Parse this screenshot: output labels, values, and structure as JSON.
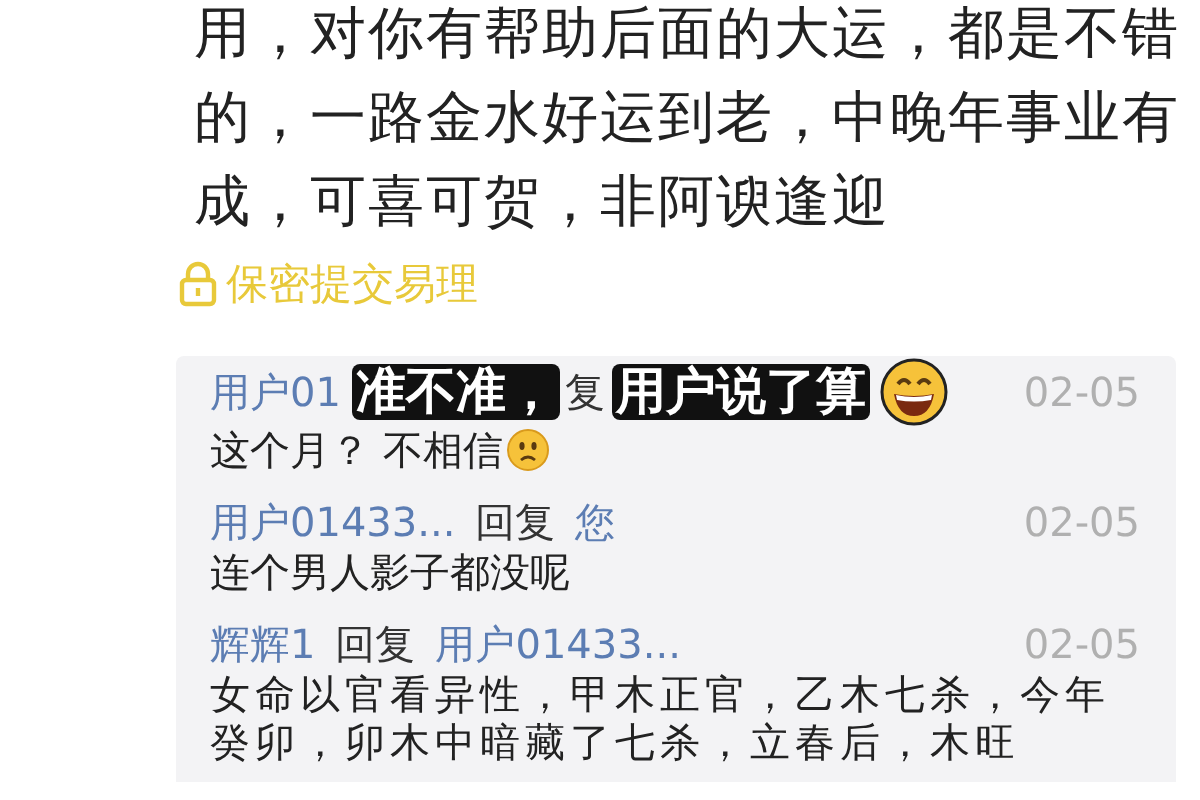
{
  "post": {
    "text": "用，对你有帮助后面的大运，都是不错的，一路金水好运到老，中晚年事业有成，可喜可贺，非阿谀逢迎",
    "lock_label": "保密提交易理"
  },
  "replies": [
    {
      "kind": "emoji",
      "author": "用户01",
      "reply_word": "复",
      "date": "02-05",
      "text": "这个月？ 不相信"
    },
    {
      "kind": "text",
      "author": "用户01433...",
      "reply_word": "回复",
      "target": "您",
      "date": "02-05",
      "text": "连个男人影子都没呢"
    },
    {
      "kind": "text",
      "author": "辉辉1",
      "reply_word": "回复",
      "target": "用户01433...",
      "date": "02-05",
      "text": "女命以官看异性，甲木正官，乙木七杀，今年癸卯，卯木中暗藏了七杀，立春后，木旺"
    }
  ],
  "caption": {
    "kind": "emoji",
    "parts": [
      "准不准，",
      "用户说了算"
    ]
  }
}
